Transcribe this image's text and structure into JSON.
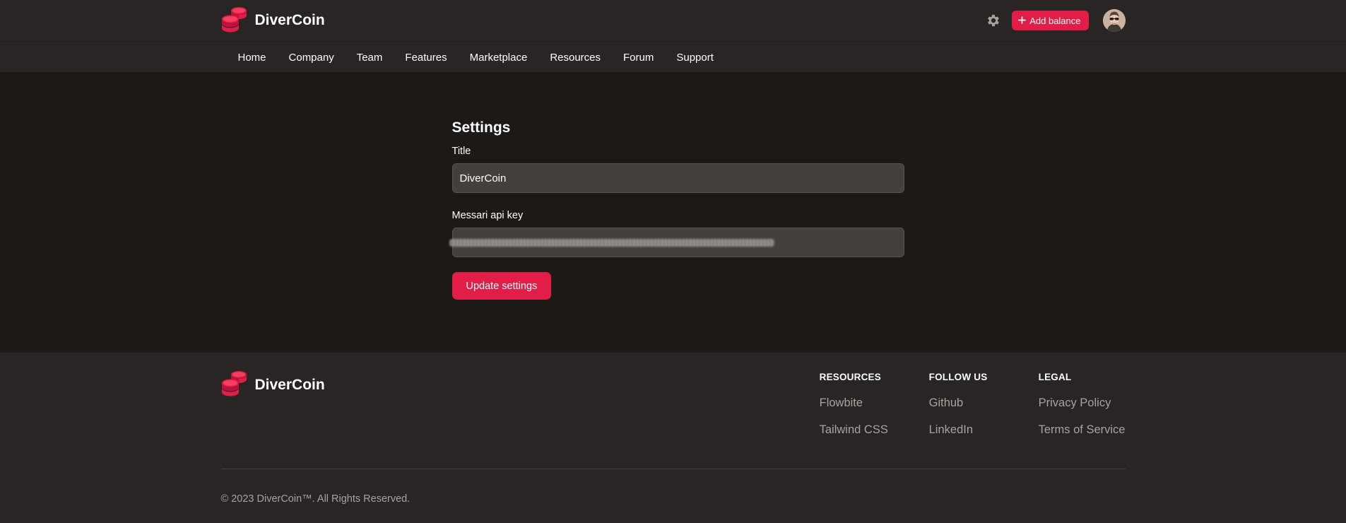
{
  "brand": {
    "name": "DiverCoin",
    "logo_icon": "coins-stack-icon",
    "accent": "#e11d48"
  },
  "header": {
    "settings_icon": "gear-icon",
    "add_balance_icon": "plus-icon",
    "add_balance_label": "Add balance",
    "avatar_alt": "User avatar"
  },
  "nav": {
    "items": [
      {
        "label": "Home"
      },
      {
        "label": "Company"
      },
      {
        "label": "Team"
      },
      {
        "label": "Features"
      },
      {
        "label": "Marketplace"
      },
      {
        "label": "Resources"
      },
      {
        "label": "Forum"
      },
      {
        "label": "Support"
      }
    ]
  },
  "settings": {
    "title": "Settings",
    "title_field": {
      "label": "Title",
      "value": "DiverCoin"
    },
    "api_key_field": {
      "label": "Messari api key",
      "value": ""
    },
    "submit_label": "Update settings"
  },
  "footer": {
    "brand_name": "DiverCoin",
    "columns": [
      {
        "heading": "RESOURCES",
        "links": [
          "Flowbite",
          "Tailwind CSS"
        ]
      },
      {
        "heading": "FOLLOW US",
        "links": [
          "Github",
          "LinkedIn"
        ]
      },
      {
        "heading": "LEGAL",
        "links": [
          "Privacy Policy",
          "Terms of Service"
        ]
      }
    ],
    "copyright": "© 2023 DiverCoin™. All Rights Reserved."
  }
}
